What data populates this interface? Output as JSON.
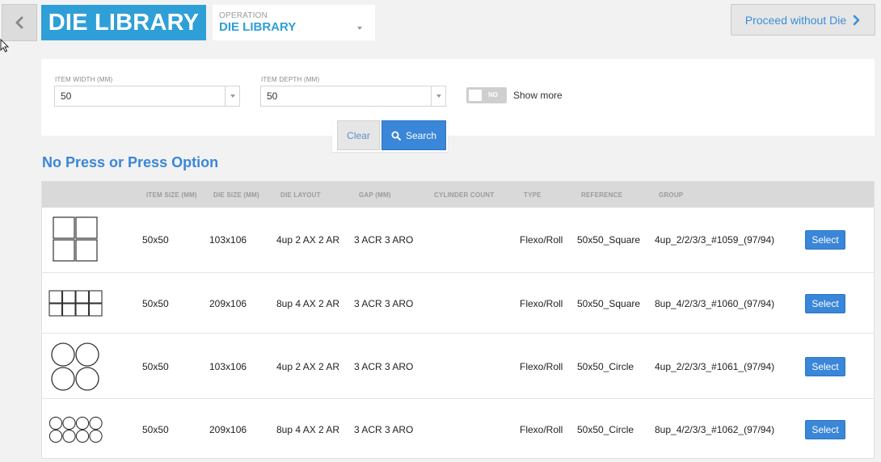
{
  "header": {
    "title": "DIE LIBRARY",
    "operation_label": "OPERATION",
    "operation_value": "DIE LIBRARY",
    "proceed_label": "Proceed without Die"
  },
  "filters": {
    "item_width_label": "ITEM WIDTH (MM)",
    "item_width_value": "50",
    "item_depth_label": "ITEM DEPTH (MM)",
    "item_depth_value": "50",
    "show_more_toggle": "NO",
    "show_more_label": "Show more",
    "clear_label": "Clear",
    "search_label": "Search"
  },
  "section_title": "No Press or Press Option",
  "table": {
    "columns": [
      "ITEM SIZE (MM)",
      "DIE SIZE (MM)",
      "DIE LAYOUT",
      "GAP (MM)",
      "CYLINDER COUNT",
      "TYPE",
      "REFERENCE",
      "GROUP"
    ],
    "rows": [
      {
        "item_size": "50x50",
        "die_size": "103x106",
        "die_layout": "4up 2 AX 2 AR",
        "gap": "3 ACR 3 ARO",
        "cylinder_count": "",
        "type": "Flexo/Roll",
        "reference": "50x50_Square",
        "group": "4up_2/2/3/3_#1059_(97/94)",
        "action": "Select",
        "thumb": "square-4up"
      },
      {
        "item_size": "50x50",
        "die_size": "209x106",
        "die_layout": "8up 4 AX 2 AR",
        "gap": "3 ACR 3 ARO",
        "cylinder_count": "",
        "type": "Flexo/Roll",
        "reference": "50x50_Square",
        "group": "8up_4/2/3/3_#1060_(97/94)",
        "action": "Select",
        "thumb": "square-8up"
      },
      {
        "item_size": "50x50",
        "die_size": "103x106",
        "die_layout": "4up 2 AX 2 AR",
        "gap": "3 ACR 3 ARO",
        "cylinder_count": "",
        "type": "Flexo/Roll",
        "reference": "50x50_Circle",
        "group": "4up_2/2/3/3_#1061_(97/94)",
        "action": "Select",
        "thumb": "circle-4up"
      },
      {
        "item_size": "50x50",
        "die_size": "209x106",
        "die_layout": "8up 4 AX 2 AR",
        "gap": "3 ACR 3 ARO",
        "cylinder_count": "",
        "type": "Flexo/Roll",
        "reference": "50x50_Circle",
        "group": "8up_4/2/3/3_#1062_(97/94)",
        "action": "Select",
        "thumb": "circle-8up"
      }
    ]
  },
  "colors": {
    "brand_blue": "#2f9fd8",
    "button_blue": "#3a86d8",
    "header_gray": "#d9d9d9"
  },
  "icons": [
    "chevron-left-icon",
    "chevron-right-icon",
    "chevron-down-icon",
    "search-icon",
    "cursor-icon"
  ]
}
